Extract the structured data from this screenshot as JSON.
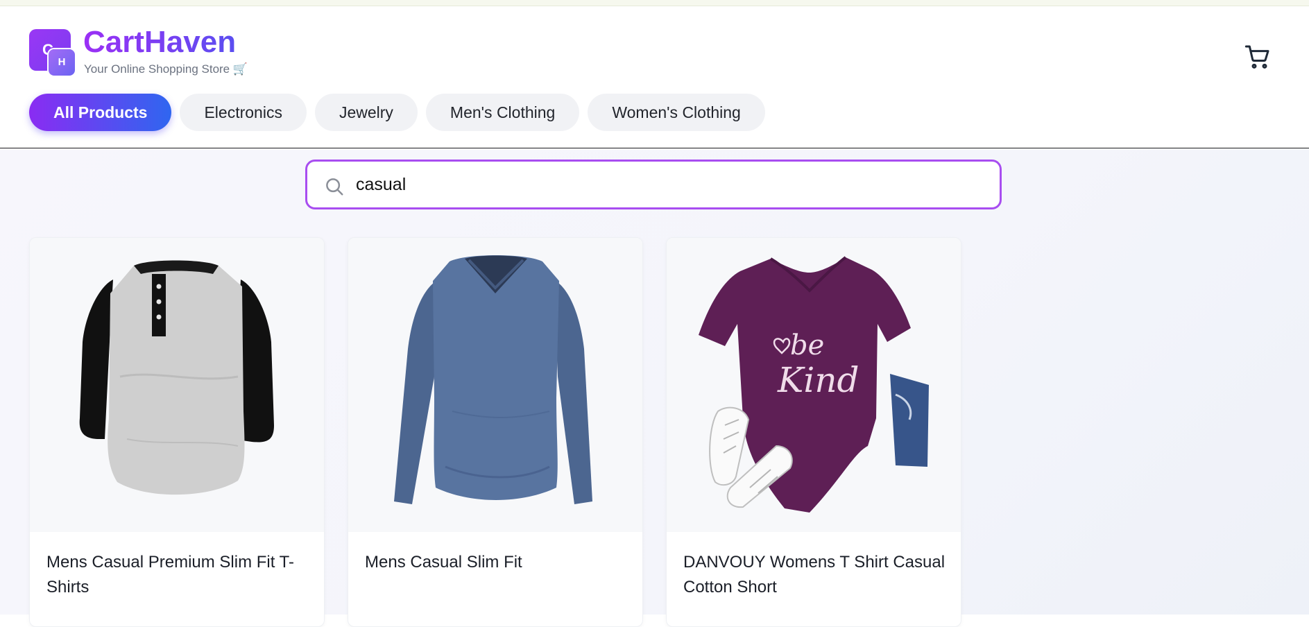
{
  "brand": {
    "logo_letters": [
      "C",
      "H"
    ],
    "name": "CartHaven",
    "tagline": "Your Online Shopping Store 🛒"
  },
  "header": {
    "cart_icon": "shopping-cart-icon"
  },
  "categories": [
    {
      "label": "All Products",
      "active": true
    },
    {
      "label": "Electronics",
      "active": false
    },
    {
      "label": "Jewelry",
      "active": false
    },
    {
      "label": "Men's Clothing",
      "active": false
    },
    {
      "label": "Women's Clothing",
      "active": false
    }
  ],
  "search": {
    "value": "casual",
    "icon": "search-icon"
  },
  "products": [
    {
      "title": "Mens Casual Premium Slim Fit T-Shirts",
      "image": "raglan-henley-shirt-grey-black"
    },
    {
      "title": "Mens Casual Slim Fit",
      "image": "long-sleeve-vneck-blue-shirt"
    },
    {
      "title": "DANVOUY Womens T Shirt Casual Cotton Short",
      "image": "purple-be-kind-tshirt-with-sneakers-jeans"
    }
  ],
  "colors": {
    "accent_purple": "#9b2ff5",
    "accent_blue": "#2f66f0",
    "search_border": "#a84df0"
  }
}
